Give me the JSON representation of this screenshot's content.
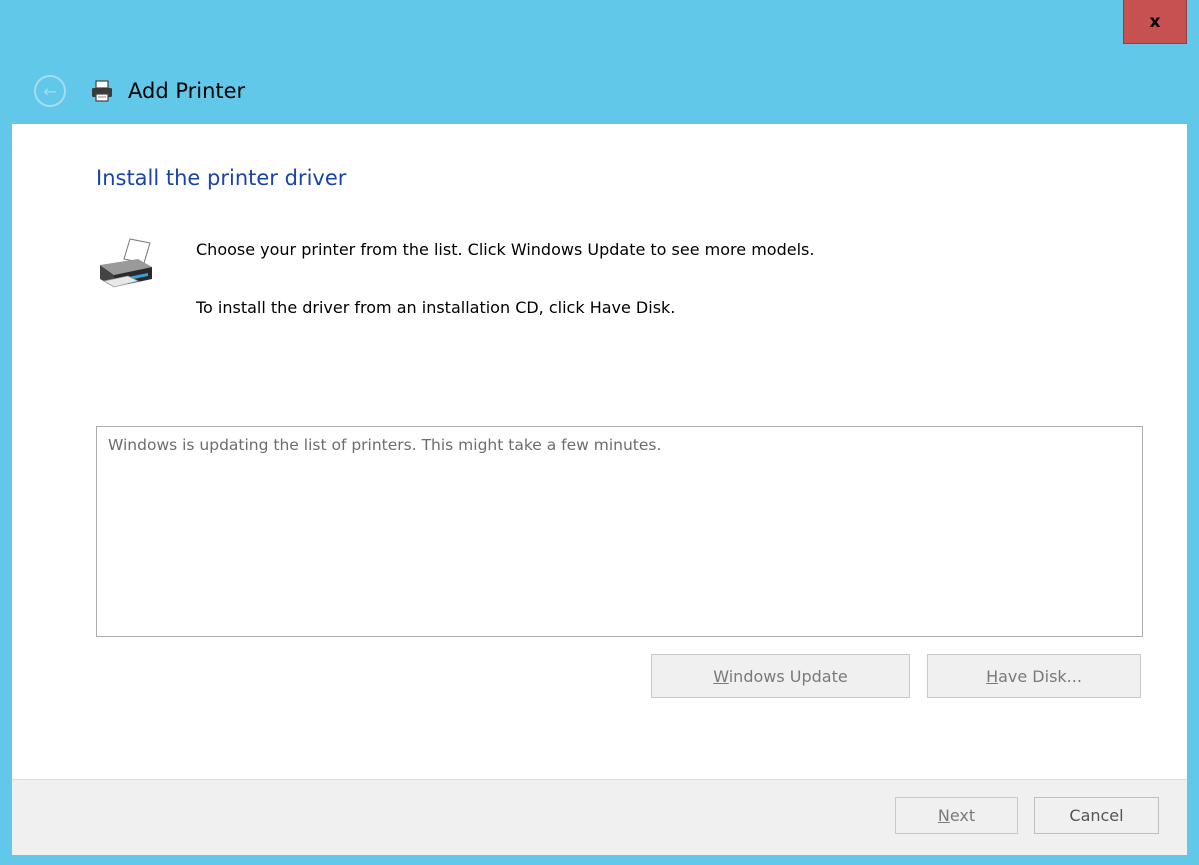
{
  "window": {
    "title": "Add Printer",
    "close_label": "x",
    "back_label": "←"
  },
  "page": {
    "heading": "Install the printer driver",
    "line1": "Choose your printer from the list. Click Windows Update to see more models.",
    "line2": "To install the driver from an installation CD, click Have Disk."
  },
  "printer_list": {
    "status": "Windows is updating the list of printers.  This might take a few minutes."
  },
  "buttons": {
    "windows_update": {
      "mnemonic": "W",
      "rest": "indows Update"
    },
    "have_disk": {
      "mnemonic": "H",
      "rest": "ave Disk..."
    },
    "next": {
      "mnemonic": "N",
      "rest": "ext"
    },
    "cancel": "Cancel"
  },
  "colors": {
    "titlebar": "#62c8ea",
    "close": "#c75050",
    "heading": "#1a44a8"
  },
  "icons": {
    "title_icon": "printer-icon",
    "content_icon": "printer-icon"
  }
}
